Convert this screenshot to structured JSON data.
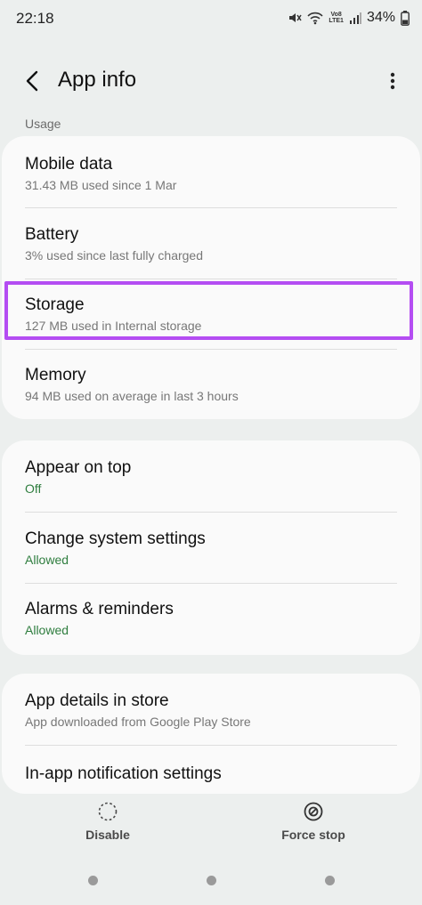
{
  "status_bar": {
    "time": "22:18",
    "lte_label": "Vo8\nLTE1",
    "battery": "34%"
  },
  "header": {
    "title": "App info"
  },
  "sections": {
    "usage_label": "Usage"
  },
  "usage": [
    {
      "title": "Mobile data",
      "subtitle": "31.43 MB used since 1 Mar"
    },
    {
      "title": "Battery",
      "subtitle": "3% used since last fully charged"
    },
    {
      "title": "Storage",
      "subtitle": "127 MB used in Internal storage"
    },
    {
      "title": "Memory",
      "subtitle": "94 MB used on average in last 3 hours"
    }
  ],
  "permissions": [
    {
      "title": "Appear on top",
      "value": "Off"
    },
    {
      "title": "Change system settings",
      "value": "Allowed"
    },
    {
      "title": "Alarms & reminders",
      "value": "Allowed"
    }
  ],
  "store": [
    {
      "title": "App details in store",
      "subtitle": "App downloaded from Google Play Store"
    },
    {
      "title": "In-app notification settings"
    }
  ],
  "bottom_bar": {
    "disable_label": "Disable",
    "force_stop_label": "Force stop"
  },
  "colors": {
    "highlight": "#b44df2",
    "status_green": "#2e7d3e",
    "background": "#ecefee"
  }
}
